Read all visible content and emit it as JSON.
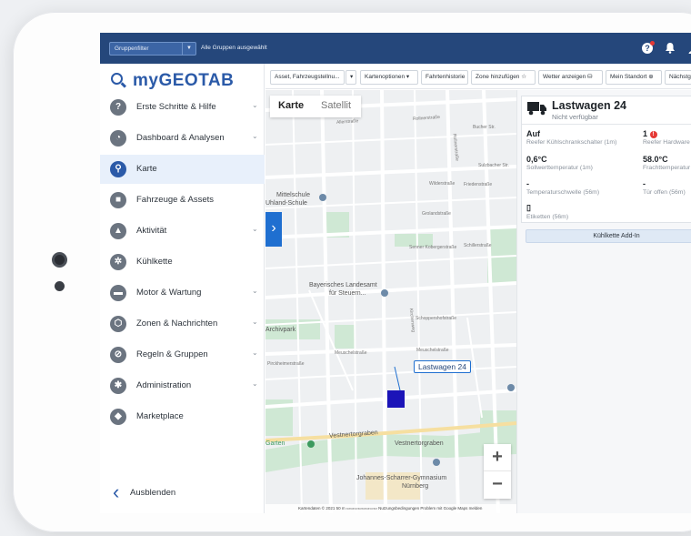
{
  "topbar": {
    "group_filter_label": "Gruppenfilter",
    "group_filter_value": "Alle Gruppen ausgewählt"
  },
  "sidebar": {
    "brand": "myGEOTAB",
    "items": [
      {
        "label": "Erste Schritte & Hilfe",
        "icon": "help-circle-icon",
        "glyph": "?",
        "chevron": true,
        "active": false
      },
      {
        "label": "Dashboard & Analysen",
        "icon": "pie-chart-icon",
        "glyph": "◔",
        "chevron": true,
        "active": false
      },
      {
        "label": "Karte",
        "icon": "map-icon",
        "glyph": "⚲",
        "chevron": false,
        "active": true
      },
      {
        "label": "Fahrzeuge & Assets",
        "icon": "truck-icon",
        "glyph": "■",
        "chevron": false,
        "active": false
      },
      {
        "label": "Aktivität",
        "icon": "activity-chart-icon",
        "glyph": "▲",
        "chevron": true,
        "active": false
      },
      {
        "label": "Kühlkette",
        "icon": "snowflake-icon",
        "glyph": "✲",
        "chevron": false,
        "active": false
      },
      {
        "label": "Motor & Wartung",
        "icon": "engine-icon",
        "glyph": "▬",
        "chevron": true,
        "active": false
      },
      {
        "label": "Zonen & Nachrichten",
        "icon": "zones-icon",
        "glyph": "⬡",
        "chevron": true,
        "active": false
      },
      {
        "label": "Regeln & Gruppen",
        "icon": "rules-icon",
        "glyph": "⊘",
        "chevron": true,
        "active": false
      },
      {
        "label": "Administration",
        "icon": "gear-icon",
        "glyph": "✱",
        "chevron": true,
        "active": false
      },
      {
        "label": "Marketplace",
        "icon": "marketplace-icon",
        "glyph": "◆",
        "chevron": false,
        "active": false
      }
    ],
    "hide_label": "Ausblenden"
  },
  "toolbar": {
    "buttons": [
      {
        "label": "Asset, Fahrzeugstellnu...",
        "icon": "search-dropdown-icon"
      },
      {
        "label": "▾",
        "icon": "chevron-down-icon"
      },
      {
        "label": "Kartenoptionen ▾",
        "icon": "map-options-icon"
      },
      {
        "label": "Fahrtenhistorie",
        "icon": "history-icon"
      },
      {
        "label": "Zone hinzufügen ☆",
        "icon": "add-zone-icon"
      },
      {
        "label": "Wetter anzeigen ⛁",
        "icon": "weather-icon"
      },
      {
        "label": "Mein Standort ⊕",
        "icon": "location-icon"
      },
      {
        "label": "Nächstgelegene",
        "icon": "nearest-icon"
      }
    ]
  },
  "map": {
    "tab_map": "Karte",
    "tab_satellite": "Satellit",
    "vehicle_label": "Lastwagen 24",
    "footer": "Kartendaten © 2021    50 m ▭▭▭▭▭▭▭▭     Nutzungsbedingungen    Problem mit Google Maps melden",
    "labels": {
      "l1": "Allerstraße",
      "l2": "Rollnerstraße",
      "l3": "Mittelschule",
      "l4": "Uhland-Schule",
      "l5": "Bayerisches Landesamt",
      "l6": "für Steuern...",
      "l7": "Archivpark",
      "l8": "Pirckheimerstraße",
      "l9": "Johannes-Scharrer-Gymnasium",
      "l10": "Nürnberg",
      "l11": "Vestnertorgraben",
      "l12": "Garten",
      "l13": "Rollnerstraße",
      "l14": "Wilderstraße",
      "l15": "Friedenstraße",
      "l16": "Schoppershofstraße",
      "l17": "Meuschelstraße",
      "l18": "Kirchenweg",
      "l19": "Bucher Str.",
      "l20": "Grolandstraße",
      "l21": "Senner Kobergerstraße",
      "l22": "Schillerstraße",
      "l23": "Meuschelstraße",
      "l24": "Vestnertorgraben",
      "l25": "Sulzbacher Str."
    }
  },
  "panel": {
    "vehicle_name": "Lastwagen 24",
    "vehicle_status": "Nicht verfügbar",
    "stats": [
      {
        "value": "Auf",
        "label": "Reefer Kühlschrankschalter (1m)"
      },
      {
        "value": "1",
        "label": "Reefer Hardware",
        "badge": "!"
      },
      {
        "value": "0,6°C",
        "label": "Sollwerttemperatur (1m)"
      },
      {
        "value": "58.0°C",
        "label": "Frachttemperatur"
      },
      {
        "value": "-",
        "label": "Temperaturschwelle (56m)"
      },
      {
        "value": "-",
        "label": "Tür offen (56m)"
      },
      {
        "value": "▯",
        "label": "Etiketten (56m)"
      }
    ],
    "addin_label": "Kühlkette Add-In"
  }
}
